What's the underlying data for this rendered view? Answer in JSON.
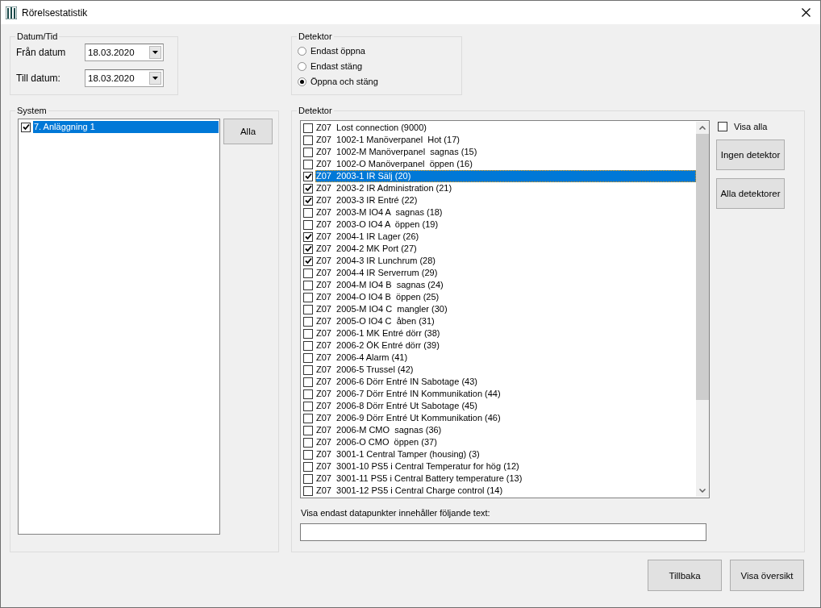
{
  "window": {
    "title": "Rörelsestatistik"
  },
  "datetime": {
    "title": "Datum/Tid",
    "fields": [
      {
        "label": "Från datum",
        "value": "18.03.2020"
      },
      {
        "label": "Till datum:",
        "value": "18.03.2020"
      }
    ]
  },
  "mode": {
    "title": "Detektor",
    "options": [
      {
        "label": "Endast öppna",
        "selected": false
      },
      {
        "label": "Endast stäng",
        "selected": false
      },
      {
        "label": "Öppna och stäng",
        "selected": true
      }
    ]
  },
  "system": {
    "title": "System",
    "items": [
      {
        "label": "7. Anläggning 1",
        "checked": true,
        "selected": true
      }
    ],
    "button": "Alla"
  },
  "detectors": {
    "title": "Detektor",
    "items": [
      {
        "label": "Z07  Lost connection (9000)",
        "checked": false,
        "selected": false
      },
      {
        "label": "Z07  1002-1 Manöverpanel  Hot (17)",
        "checked": false,
        "selected": false
      },
      {
        "label": "Z07  1002-M Manöverpanel  sagnas (15)",
        "checked": false,
        "selected": false
      },
      {
        "label": "Z07  1002-O Manöverpanel  öppen (16)",
        "checked": false,
        "selected": false
      },
      {
        "label": "Z07  2003-1 IR Sälj (20)",
        "checked": true,
        "selected": true
      },
      {
        "label": "Z07  2003-2 IR Administration (21)",
        "checked": true,
        "selected": false
      },
      {
        "label": "Z07  2003-3 IR Entré (22)",
        "checked": true,
        "selected": false
      },
      {
        "label": "Z07  2003-M IO4 A  sagnas (18)",
        "checked": false,
        "selected": false
      },
      {
        "label": "Z07  2003-O IO4 A  öppen (19)",
        "checked": false,
        "selected": false
      },
      {
        "label": "Z07  2004-1 IR Lager (26)",
        "checked": true,
        "selected": false
      },
      {
        "label": "Z07  2004-2 MK Port (27)",
        "checked": true,
        "selected": false
      },
      {
        "label": "Z07  2004-3 IR Lunchrum (28)",
        "checked": true,
        "selected": false
      },
      {
        "label": "Z07  2004-4 IR Serverrum (29)",
        "checked": false,
        "selected": false
      },
      {
        "label": "Z07  2004-M IO4 B  sagnas (24)",
        "checked": false,
        "selected": false
      },
      {
        "label": "Z07  2004-O IO4 B  öppen (25)",
        "checked": false,
        "selected": false
      },
      {
        "label": "Z07  2005-M IO4 C  mangler (30)",
        "checked": false,
        "selected": false
      },
      {
        "label": "Z07  2005-O IO4 C  åben (31)",
        "checked": false,
        "selected": false
      },
      {
        "label": "Z07  2006-1 MK Entré dörr (38)",
        "checked": false,
        "selected": false
      },
      {
        "label": "Z07  2006-2 ÖK Entré dörr (39)",
        "checked": false,
        "selected": false
      },
      {
        "label": "Z07  2006-4 Alarm (41)",
        "checked": false,
        "selected": false
      },
      {
        "label": "Z07  2006-5 Trussel (42)",
        "checked": false,
        "selected": false
      },
      {
        "label": "Z07  2006-6 Dörr Entré IN Sabotage (43)",
        "checked": false,
        "selected": false
      },
      {
        "label": "Z07  2006-7 Dörr Entré IN Kommunikation (44)",
        "checked": false,
        "selected": false
      },
      {
        "label": "Z07  2006-8 Dörr Entré Ut Sabotage (45)",
        "checked": false,
        "selected": false
      },
      {
        "label": "Z07  2006-9 Dörr Entré Ut Kommunikation (46)",
        "checked": false,
        "selected": false
      },
      {
        "label": "Z07  2006-M CMO  sagnas (36)",
        "checked": false,
        "selected": false
      },
      {
        "label": "Z07  2006-O CMO  öppen (37)",
        "checked": false,
        "selected": false
      },
      {
        "label": "Z07  3001-1 Central Tamper (housing) (3)",
        "checked": false,
        "selected": false
      },
      {
        "label": "Z07  3001-10 PS5 i Central Temperatur for hög (12)",
        "checked": false,
        "selected": false
      },
      {
        "label": "Z07  3001-11 PS5 i Central Battery temperature (13)",
        "checked": false,
        "selected": false
      },
      {
        "label": "Z07  3001-12 PS5 i Central Charge control (14)",
        "checked": false,
        "selected": false
      }
    ],
    "show_all": {
      "label": "Visa alla",
      "checked": false
    },
    "buttons": [
      "Ingen detektor",
      "Alla detektorer"
    ],
    "filter": {
      "label": "Visa endast datapunkter innehåller följande text:"
    }
  },
  "footer_buttons": [
    "Tillbaka",
    "Visa översikt"
  ]
}
